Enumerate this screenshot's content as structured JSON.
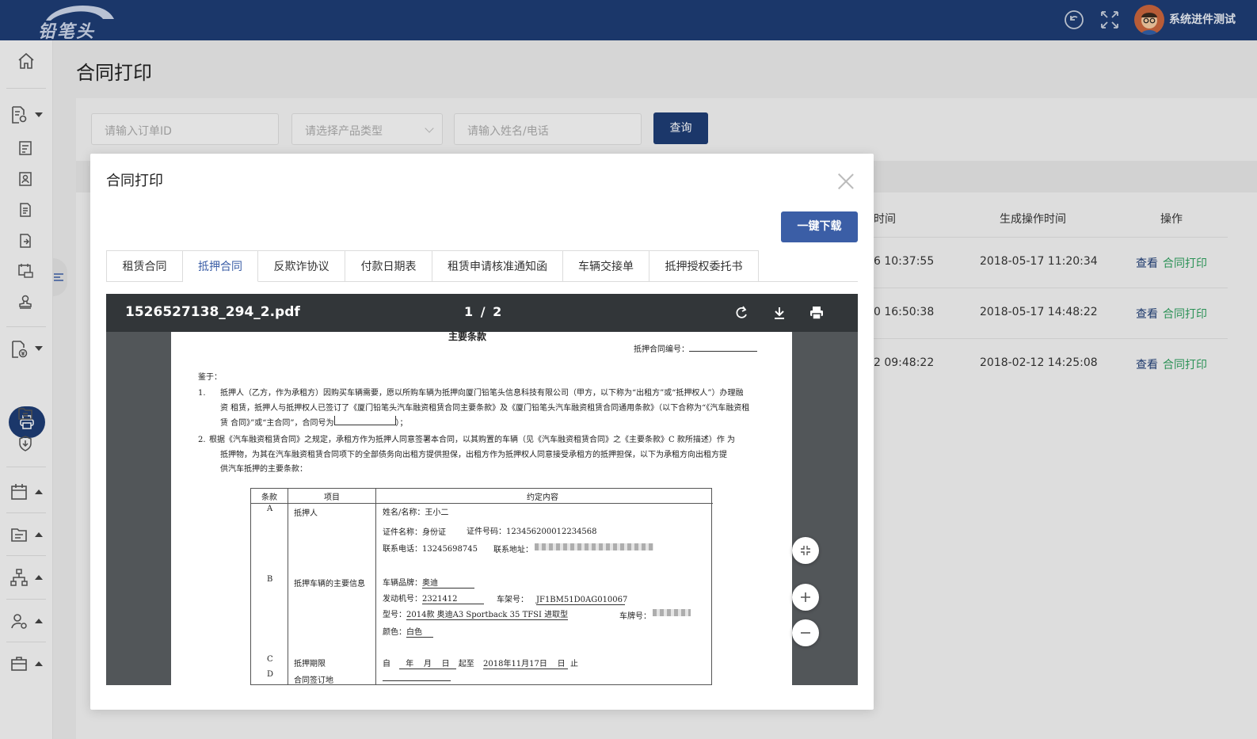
{
  "header": {
    "logo_text": "铅笔头",
    "user_name": "系统进件测试",
    "icons": [
      "refresh-icon",
      "fullscreen-icon",
      "avatar"
    ]
  },
  "page": {
    "title": "合同打印"
  },
  "filters": {
    "order_placeholder": "请输入订单ID",
    "product_placeholder": "请选择产品类型",
    "name_placeholder": "请输入姓名/电话",
    "query_label": "查询"
  },
  "table": {
    "headers": [
      "时间",
      "生成操作时间",
      "操作"
    ],
    "rows": [
      {
        "time": "6 10:37:55",
        "gen_time": "2018-05-17 11:20:34",
        "view": "查看",
        "print": "合同打印"
      },
      {
        "time": "0 16:50:38",
        "gen_time": "2018-05-17 14:48:22",
        "view": "查看",
        "print": "合同打印"
      },
      {
        "time": "2 09:48:22",
        "gen_time": "2018-02-12 14:25:08",
        "view": "查看",
        "print": "合同打印"
      }
    ]
  },
  "modal": {
    "title": "合同打印",
    "download_label": "一键下载",
    "tabs": [
      "租赁合同",
      "抵押合同",
      "反欺诈协议",
      "付款日期表",
      "租赁申请核准通知函",
      "车辆交接单",
      "抵押授权委托书"
    ],
    "active_tab": "抵押合同"
  },
  "viewer": {
    "filename": "1526527138_294_2.pdf",
    "page_current": "1",
    "page_sep": "/",
    "page_total": "2"
  },
  "pdf": {
    "heading": "主要条款",
    "contract_no_label": "抵押合同编号：",
    "whereas": "鉴于：",
    "clause1_num": "1.",
    "clause1_l1": "抵押人（乙方，作为承租方）因购买车辆需要，愿以所购车辆为抵押向厦门铅笔头信息科技有限公司（甲方，以下称为“出租方”或“抵押权人”）办理融",
    "clause1_l2": "资 租赁，抵押人与抵押权人已签订了《厦门铅笔头汽车融资租赁合同主要条款》及《厦门铅笔头汽车融资租赁合同通用条款》（以下合称为“《汽车融资租",
    "clause1_l3": "赁 合同》”或“主合同”，合同号为",
    "clause1_l3_end": "）；",
    "clause2_num": "2.",
    "clause2_l1": "根据《汽车融资租赁合同》之规定，承租方作为抵押人同意签署本合同，以其购置的车辆（见《汽车融资租赁合同》之《主要条款》C 款所描述）作 为",
    "clause2_l2": "抵押物，为其在汽车融资租赁合同项下的全部债务向出租方提供担保，出租方作为抵押权人同意接受承租方的抵押担保，以下为承租方向出租方提",
    "clause2_l3": "供汽车抵押的主要条款：",
    "table_headers": [
      "条款",
      "项目",
      "约定内容"
    ],
    "row_a_code": "A",
    "row_a_item": "抵押人",
    "name_label": "姓名/名称：",
    "name_value": "王小二",
    "id_type_label": "证件名称：",
    "id_type_value": "身份证",
    "id_no_label": "证件号码：",
    "id_no_value": "123456200012234568",
    "phone_label": "联系电话：",
    "phone_value": "13245698745",
    "address_label": "联系地址：",
    "row_b_code": "B",
    "row_b_item": "抵押车辆的主要信息",
    "brand_label": "车辆品牌：",
    "brand_value": "奥迪",
    "engine_label": "发动机号：",
    "engine_value": "2321412",
    "vin_label": "车架号：",
    "vin_value": "JF1BM51D0AG010067",
    "model_label": "型号：",
    "model_value": "2014款 奥迪A3 Sportback 35 TFSI 进取型",
    "plate_label": "车牌号：",
    "color_label": "颜色：",
    "color_value": "白色",
    "row_c_code": "C",
    "row_c_item": "抵押期限",
    "term_from": "自",
    "term_y": "年",
    "term_m": "月",
    "term_d": "日",
    "term_to": "起至",
    "term_date": "2018年11月17日",
    "term_d2": "日",
    "term_end": "止",
    "row_d_code": "D",
    "row_d_item": "合同签订地"
  },
  "colors": {
    "brand": "#1e3c73",
    "accent": "#3b5ea6",
    "link_print": "#2f9e5e"
  }
}
